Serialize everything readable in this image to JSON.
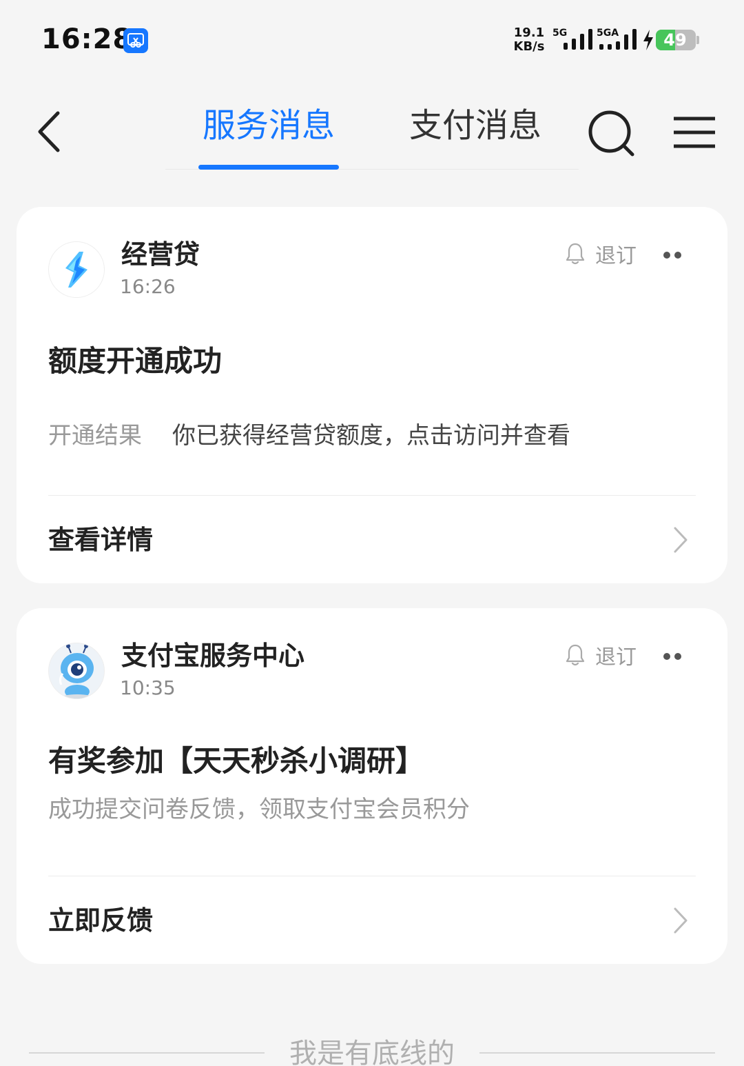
{
  "status_bar": {
    "time": "16:28",
    "net_speed": "19.1",
    "net_speed_unit": "KB/s",
    "sim1_label": "5G",
    "sim2_label": "5GA",
    "battery_level": "49",
    "battery_fraction": 0.49,
    "colors": {
      "battery_fill": "#47c55b",
      "app_icon": "#1677ff"
    }
  },
  "nav": {
    "back_icon": "chevron-left-icon",
    "tabs": [
      {
        "label": "服务消息",
        "active": true
      },
      {
        "label": "支付消息",
        "active": false
      }
    ],
    "search_icon": "search-icon",
    "menu_icon": "hamburger-menu-icon",
    "accent_color": "#1677ff"
  },
  "messages": [
    {
      "sender": "经营贷",
      "time": "16:26",
      "unsubscribe_label": "退订",
      "title": "额度开通成功",
      "result_label": "开通结果",
      "result_text": "你已获得经营贷额度，点击访问并查看",
      "action_label": "查看详情",
      "avatar_icon": "jingyingdai-logo-icon"
    },
    {
      "sender": "支付宝服务中心",
      "time": "10:35",
      "unsubscribe_label": "退订",
      "title": "有奖参加【天天秒杀小调研】",
      "description": "成功提交问卷反馈，领取支付宝会员积分",
      "action_label": "立即反馈",
      "avatar_icon": "ant-mascot-icon"
    }
  ],
  "footer": {
    "text": "我是有底线的"
  }
}
